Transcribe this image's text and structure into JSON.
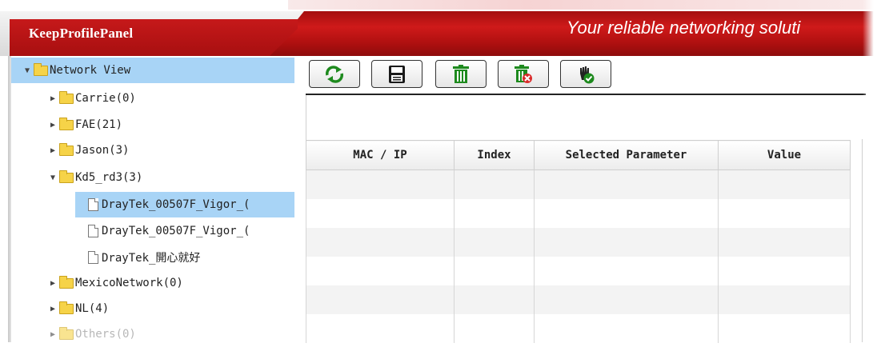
{
  "header": {
    "panel_title": "KeepProfilePanel",
    "tagline": "Your reliable networking soluti"
  },
  "tree": {
    "root": {
      "label": "Network View",
      "expanded": true,
      "selected": true
    },
    "items": [
      {
        "label": "Carrie(0)",
        "type": "folder",
        "expanded": false
      },
      {
        "label": "FAE(21)",
        "type": "folder",
        "expanded": false
      },
      {
        "label": "Jason(3)",
        "type": "folder",
        "expanded": false
      },
      {
        "label": "Kd5_rd3(3)",
        "type": "folder",
        "expanded": true,
        "children": [
          {
            "label": "DrayTek_00507F_Vigor_(",
            "type": "file",
            "selected": true
          },
          {
            "label": "DrayTek_00507F_Vigor_(",
            "type": "file"
          },
          {
            "label": "DrayTek_開心就好",
            "type": "file"
          }
        ]
      },
      {
        "label": "MexicoNetwork(0)",
        "type": "folder",
        "expanded": false
      },
      {
        "label": "NL(4)",
        "type": "folder",
        "expanded": false
      },
      {
        "label": "Others(0)",
        "type": "folder",
        "expanded": false
      }
    ]
  },
  "toolbar": {
    "buttons": [
      {
        "name": "refresh",
        "icon": "refresh-icon"
      },
      {
        "name": "save",
        "icon": "save-icon"
      },
      {
        "name": "delete",
        "icon": "trash-icon"
      },
      {
        "name": "delete-selected",
        "icon": "trash-x-icon"
      },
      {
        "name": "apply",
        "icon": "hand-check-icon"
      }
    ]
  },
  "grid": {
    "columns": [
      "MAC / IP",
      "Index",
      "Selected Parameter",
      "Value"
    ],
    "rows": []
  },
  "colors": {
    "header_red": "#b51212",
    "selection_blue": "#a8d4f6",
    "icon_green": "#1e8a1e"
  }
}
